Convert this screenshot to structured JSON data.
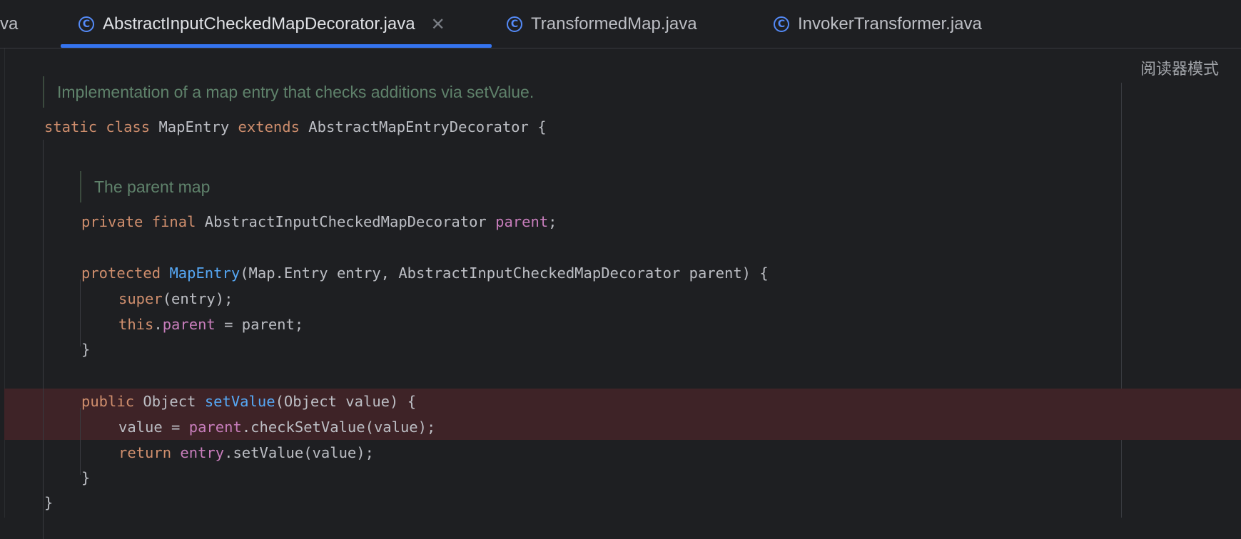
{
  "tabs": [
    {
      "label": "va",
      "icon": "class-icon",
      "active": false,
      "closable": false
    },
    {
      "label": "AbstractInputCheckedMapDecorator.java",
      "icon": "class-icon",
      "active": true,
      "closable": true
    },
    {
      "label": "TransformedMap.java",
      "icon": "class-icon",
      "active": false,
      "closable": false
    },
    {
      "label": "InvokerTransformer.java",
      "icon": "class-icon",
      "active": false,
      "closable": false
    }
  ],
  "icons": {
    "class_glyph": "C",
    "close_glyph": "✕"
  },
  "editor": {
    "reader_mode_label": "阅读器模式",
    "doc_comments": [
      "Implementation of a map entry that checks additions via setValue.",
      "The parent map"
    ],
    "code": {
      "l1": {
        "t0": "static",
        "t1": " ",
        "t2": "class",
        "t3": " MapEntry ",
        "t4": "extends",
        "t5": " AbstractMapEntryDecorator {"
      },
      "l2": {
        "t0": "private",
        "t1": " ",
        "t2": "final",
        "t3": " AbstractInputCheckedMapDecorator ",
        "t4": "parent",
        "t5": ";"
      },
      "l3": {
        "t0": "protected",
        "t1": " ",
        "t2": "MapEntry",
        "t3": "(Map.Entry entry, AbstractInputCheckedMapDecorator parent) {"
      },
      "l4": {
        "t0": "super",
        "t1": "(entry);"
      },
      "l5": {
        "t0": "this",
        "t1": ".",
        "t2": "parent",
        "t3": " = parent;"
      },
      "l6": {
        "t0": "}"
      },
      "l7": {
        "t0": "public",
        "t1": " Object ",
        "t2": "setValue",
        "t3": "(Object value) {"
      },
      "l8": {
        "t0": "value = ",
        "t1": "parent",
        "t2": ".checkSetValue(value);"
      },
      "l9": {
        "t0": "return",
        "t1": " ",
        "t2": "entry",
        "t3": ".setValue(value);"
      },
      "l10": {
        "t0": "}"
      },
      "l11": {
        "t0": "}"
      }
    }
  },
  "colors": {
    "background": "#1e1f22",
    "keyword": "#cf8e6d",
    "field": "#c77dbb",
    "method": "#56a8f5",
    "doc_comment": "#5f826b",
    "highlight_line": "#3e2327",
    "active_tab_underline": "#3574f0"
  }
}
